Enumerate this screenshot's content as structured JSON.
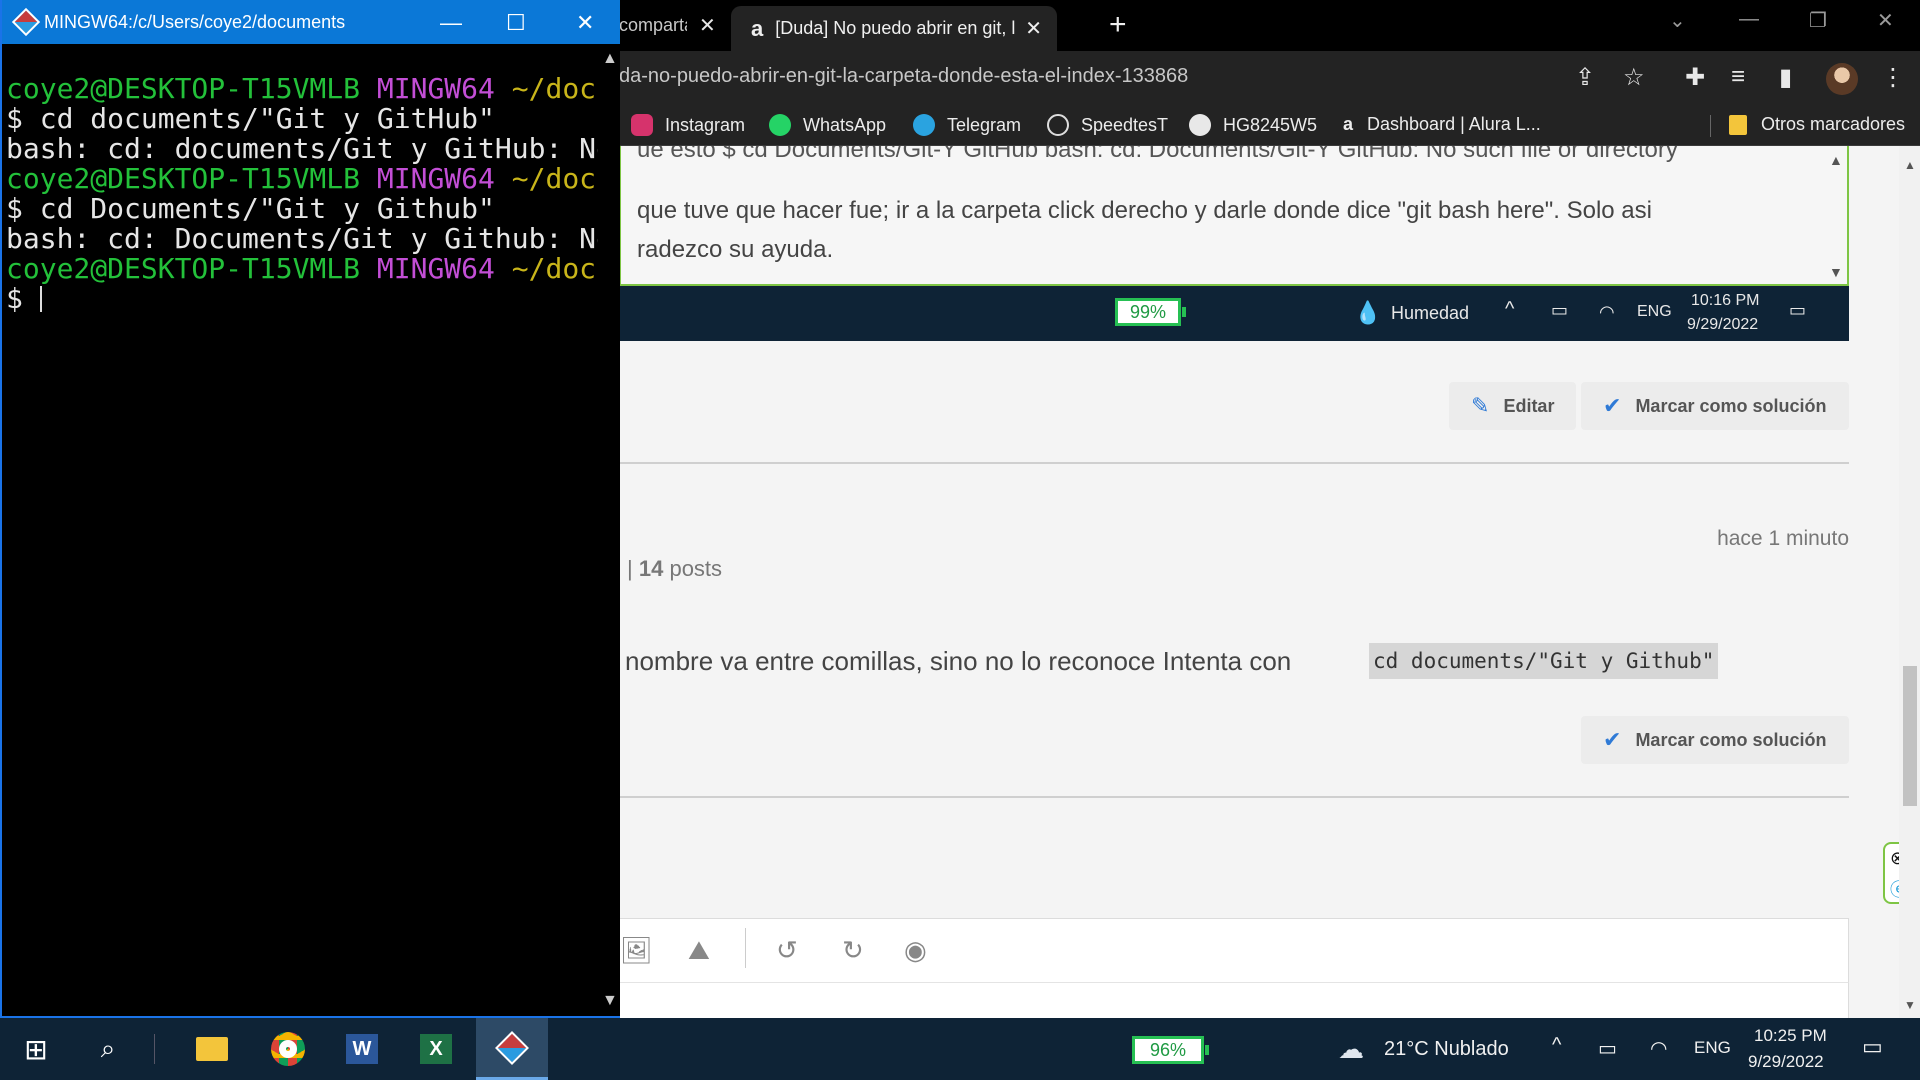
{
  "bash": {
    "title": "MINGW64:/c/Users/coye2/documents",
    "blocks": [
      {
        "prompt_user": "coye2@DESKTOP-T15VMLB",
        "prompt_sys": "MINGW64",
        "prompt_path": "~/documents",
        "command": "$ cd documents/\"Git y GitHub\"",
        "output": "bash: cd: documents/Git y GitHub: No such file or directory"
      },
      {
        "prompt_user": "coye2@DESKTOP-T15VMLB",
        "prompt_sys": "MINGW64",
        "prompt_path": "~/documents",
        "command": "$ cd Documents/\"Git y Github\"",
        "output": "bash: cd: Documents/Git y Github: No such file or directory"
      },
      {
        "prompt_user": "coye2@DESKTOP-T15VMLB",
        "prompt_sys": "MINGW64",
        "prompt_path": "~/documents",
        "command": "$ ",
        "output": ""
      }
    ]
  },
  "chrome": {
    "tabs": [
      {
        "label": "comparta"
      },
      {
        "label": "[Duda] No puedo abrir en git, la carpeta",
        "favicon": "a"
      }
    ],
    "url": "da-no-puedo-abrir-en-git-la-carpeta-donde-esta-el-index-133868",
    "bookmarks": [
      {
        "label": "Instagram",
        "color": "#d6336c"
      },
      {
        "label": "WhatsApp",
        "color": "#25d366"
      },
      {
        "label": "Telegram",
        "color": "#2aa3e0"
      },
      {
        "label": "SpeedtesT",
        "color": "#1a1a1a"
      },
      {
        "label": "HG8245W5",
        "color": "#e8e8e8"
      },
      {
        "label": "Dashboard | Alura L...",
        "color": "#232323"
      }
    ],
    "other_bookmarks": "Otros marcadores"
  },
  "embedded": {
    "line1": "ue esto $ cd Documents/Git-Y GitHub bash: cd: Documents/Git-Y GitHub: No such file or directory",
    "line2": "que tuve que hacer fue; ir a la carpeta click derecho y darle donde dice \"git bash here\". Solo asi",
    "line3": "radezco su ayuda.",
    "battery": "99%",
    "weather": "Humedad",
    "lang": "ENG",
    "time": "10:16 PM",
    "date": "9/29/2022"
  },
  "post": {
    "edit_label": "Editar",
    "solution_label": "Marcar como solución"
  },
  "reply": {
    "posts_count": "14",
    "posts_word": "posts",
    "time": "hace 1 minuto",
    "text": "nombre va entre comillas, sino no lo reconoce Intenta con",
    "code": "cd documents/\"Git y Github\"",
    "solution_label": "Marcar como solución"
  },
  "taskbar": {
    "battery": "96%",
    "weather": "21°C  Nublado",
    "lang": "ENG",
    "time": "10:25 PM",
    "date": "9/29/2022"
  }
}
